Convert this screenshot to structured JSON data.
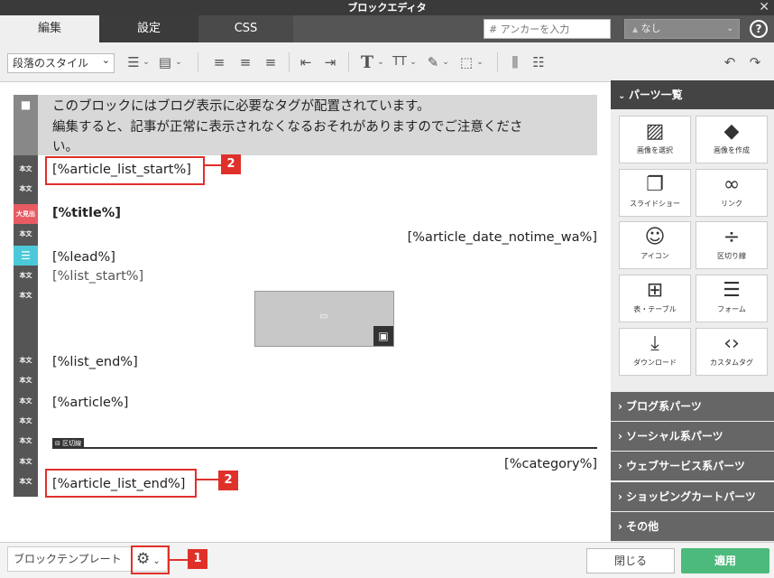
{
  "window": {
    "title": "ブロックエディタ",
    "close": "✕"
  },
  "tabs": [
    "編集",
    "設定",
    "CSS"
  ],
  "anchor": {
    "placeholder": "# アンカーを入力",
    "select_value": "なし",
    "select_icon": "▲"
  },
  "help": "?",
  "toolbar": {
    "style_select": "段落のスタイル",
    "style_caret": "⌄"
  },
  "editor": {
    "notice_lines": [
      "このブロックにはブログ表示に必要なタグが配置されています。",
      "編集すると、記事が正常に表示されなくなるおそれがありますのでご注意くださ",
      "い。"
    ],
    "tag_list_start": "[%article_list_start%]",
    "tag_title": "[%title%]",
    "tag_date": "[%article_date_notime_wa%]",
    "tag_lead": "[%lead%]",
    "tag_list_start2": "[%list_start%]",
    "tag_list_end": "[%list_end%]",
    "tag_article": "[%article%]",
    "divider_label": "区切線",
    "tag_category": "[%category%]",
    "tag_list_end2": "[%article_list_end%]",
    "labels": {
      "body": "本文",
      "heading": "大見出"
    }
  },
  "sidebar": {
    "header": "パーツ一覧",
    "parts": [
      {
        "label": "画像を選択",
        "icon": "image-icon"
      },
      {
        "label": "画像を作成",
        "icon": "shapes-icon"
      },
      {
        "label": "スライドショー",
        "icon": "slideshow-icon"
      },
      {
        "label": "リンク",
        "icon": "link-icon"
      },
      {
        "label": "アイコン",
        "icon": "smile-icon"
      },
      {
        "label": "区切り線",
        "icon": "divider-icon"
      },
      {
        "label": "表・テーブル",
        "icon": "table-icon"
      },
      {
        "label": "フォーム",
        "icon": "form-icon"
      },
      {
        "label": "ダウンロード",
        "icon": "download-icon"
      },
      {
        "label": "カスタムタグ",
        "icon": "code-icon"
      }
    ],
    "categories": [
      "ブログ系パーツ",
      "ソーシャル系パーツ",
      "ウェブサービス系パーツ",
      "ショッピングカートパーツ",
      "その他"
    ]
  },
  "bottom": {
    "template_button": "ブロックテンプレート",
    "close_button": "閉じる",
    "apply_button": "適用"
  },
  "callouts": [
    "1",
    "2",
    "2"
  ],
  "colors": {
    "accent": "#e0302a",
    "apply": "#4cba7c",
    "heading_label": "#e85b62",
    "lead_label": "#4cc9d8"
  }
}
